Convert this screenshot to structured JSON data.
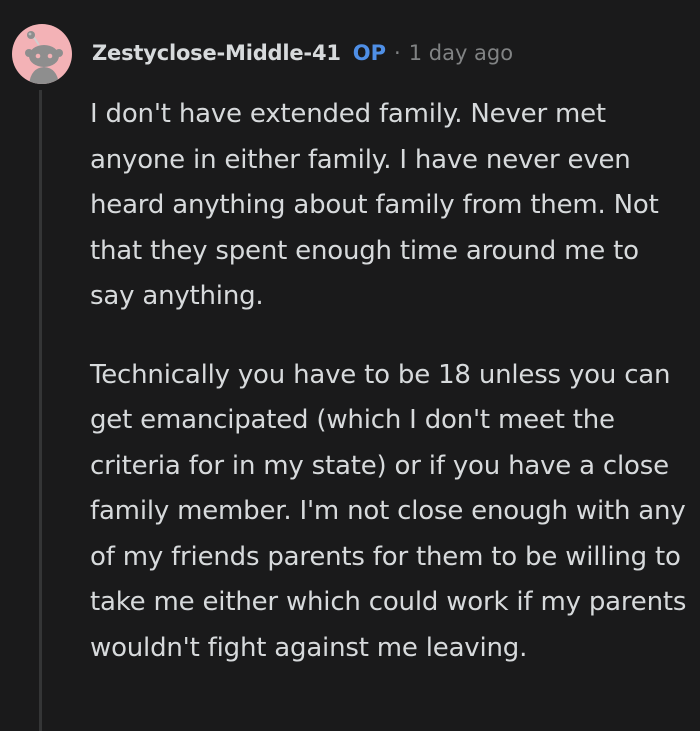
{
  "comment": {
    "author": "Zestyclose-Middle-41",
    "op_badge": "OP",
    "separator": "·",
    "timestamp": "1 day ago",
    "avatar_icon": "snoo-avatar-icon",
    "paragraphs": [
      "I don't have extended family. Never met anyone in either family. I have never even heard anything about family from them. Not that they spent enough time around me to say anything.",
      "Technically you have to be 18 unless you can get emancipated (which I don't meet the criteria for in my state) or if you have a close family member. I'm not close enough with any of my friends parents for them to be willing to take me either which could work if my parents wouldn't fight against me leaving."
    ]
  },
  "colors": {
    "background": "#1a1a1b",
    "text": "#d7dadc",
    "muted": "#818384",
    "op": "#4f8fe6",
    "avatar_bg": "#f3b2b6",
    "thread_line": "#343536"
  }
}
